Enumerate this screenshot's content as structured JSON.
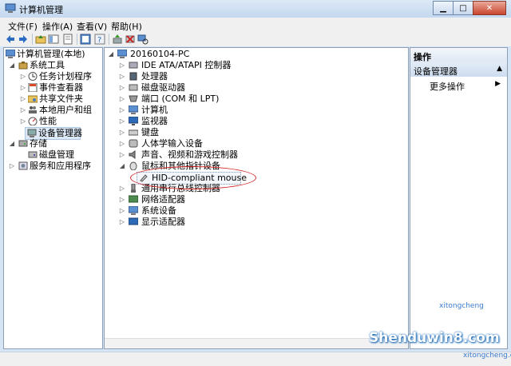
{
  "window": {
    "title": "计算机管理"
  },
  "menu": {
    "file": "文件(F)",
    "action": "操作(A)",
    "view": "查看(V)",
    "help": "帮助(H)"
  },
  "left_tree": {
    "root": "计算机管理(本地)",
    "system_tools": "系统工具",
    "task_scheduler": "任务计划程序",
    "event_viewer": "事件查看器",
    "shared_folders": "共享文件夹",
    "local_users": "本地用户和组",
    "performance": "性能",
    "device_manager": "设备管理器",
    "storage": "存储",
    "disk_management": "磁盘管理",
    "services": "服务和应用程序"
  },
  "device_tree": {
    "computer": "20160104-PC",
    "items": [
      "IDE ATA/ATAPI 控制器",
      "处理器",
      "磁盘驱动器",
      "端口 (COM 和 LPT)",
      "计算机",
      "监视器",
      "键盘",
      "人体学输入设备",
      "声音、视频和游戏控制器",
      "鼠标和其他指针设备"
    ],
    "mouse_child": "HID-compliant mouse",
    "items_after": [
      "通用串行总线控制器",
      "网络适配器",
      "系统设备",
      "显示适配器"
    ]
  },
  "actions": {
    "header": "操作",
    "section": "设备管理器",
    "more": "更多操作"
  },
  "watermark": {
    "main": "Shenduwin8.com",
    "top": "xitongcheng",
    "bottom": "xitongcheng.com"
  }
}
